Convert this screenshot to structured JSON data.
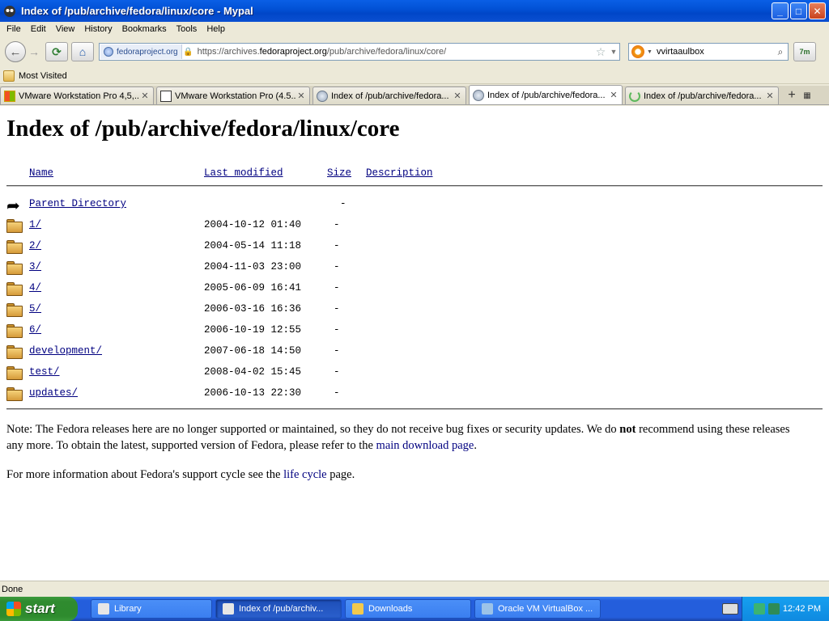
{
  "window": {
    "title": "Index of /pub/archive/fedora/linux/core - Mypal",
    "buttons": {
      "minimize": "_",
      "maximize": "□",
      "close": "✕"
    }
  },
  "menu": [
    "File",
    "Edit",
    "View",
    "History",
    "Bookmarks",
    "Tools",
    "Help"
  ],
  "nav": {
    "identity": "fedoraproject.org",
    "url_prefix": "https://archives.",
    "url_domain": "fedoraproject.org",
    "url_path": "/pub/archive/fedora/linux/core/",
    "search_value": "vvirtaaulbox",
    "addon_label": "7m"
  },
  "bookmarks": {
    "most_visited": "Most Visited"
  },
  "tabs": [
    {
      "label": "VMware Workstation Pro 4,5,...",
      "favicon": "vmware-icon",
      "active": false
    },
    {
      "label": "VMware Workstation Pro (4.5...",
      "favicon": "vm-icon",
      "active": false
    },
    {
      "label": "Index of /pub/archive/fedora...",
      "favicon": "globe-icon",
      "active": false
    },
    {
      "label": "Index of /pub/archive/fedora...",
      "favicon": "globe-icon",
      "active": true
    },
    {
      "label": "Index of /pub/archive/fedora...",
      "favicon": "loading-icon",
      "active": false
    }
  ],
  "page": {
    "heading": "Index of /pub/archive/fedora/linux/core",
    "columns": {
      "name": "Name",
      "modified": "Last modified",
      "size": "Size",
      "description": "Description"
    },
    "parent": {
      "name": "Parent Directory",
      "size": "-"
    },
    "entries": [
      {
        "name": "1/",
        "modified": "2004-10-12 01:40",
        "size": "-"
      },
      {
        "name": "2/",
        "modified": "2004-05-14 11:18",
        "size": "-"
      },
      {
        "name": "3/",
        "modified": "2004-11-03 23:00",
        "size": "-"
      },
      {
        "name": "4/",
        "modified": "2005-06-09 16:41",
        "size": "-"
      },
      {
        "name": "5/",
        "modified": "2006-03-16 16:36",
        "size": "-"
      },
      {
        "name": "6/",
        "modified": "2006-10-19 12:55",
        "size": "-"
      },
      {
        "name": "development/",
        "modified": "2007-06-18 14:50",
        "size": "-"
      },
      {
        "name": "test/",
        "modified": "2008-04-02 15:45",
        "size": "-"
      },
      {
        "name": "updates/",
        "modified": "2006-10-13 22:30",
        "size": "-"
      }
    ],
    "note": {
      "part1": "Note: The Fedora releases here are no longer supported or maintained, so they do not receive bug fixes or security updates. We do ",
      "bold": "not",
      "part2": " recommend using these releases any more. To obtain the latest, supported version of Fedora, please refer to the ",
      "link": "main download page",
      "part3": "."
    },
    "info": {
      "part1": "For more information about Fedora's support cycle see the ",
      "link": "life cycle",
      "part2": " page."
    }
  },
  "status": "Done",
  "taskbar": {
    "start": "start",
    "tasks": [
      {
        "label": "Library",
        "active": false
      },
      {
        "label": "Index of /pub/archiv...",
        "active": true
      },
      {
        "label": "Downloads",
        "active": false
      },
      {
        "label": "Oracle VM VirtualBox ...",
        "active": false
      }
    ],
    "clock": "12:42 PM"
  }
}
